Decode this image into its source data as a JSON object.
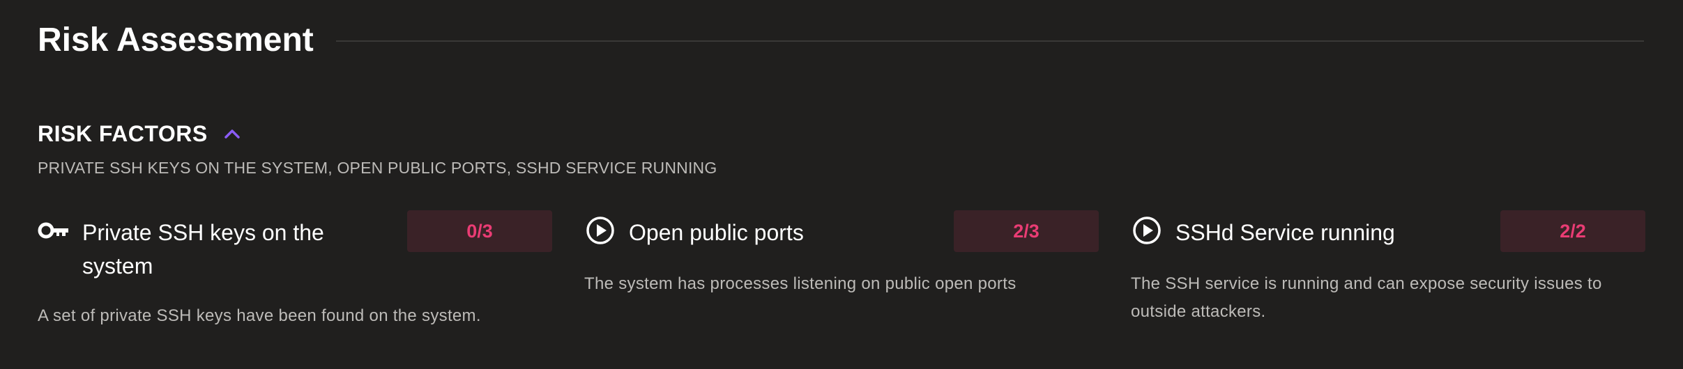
{
  "section": {
    "title": "Risk Assessment"
  },
  "risk_factors": {
    "heading": "RISK FACTORS",
    "summary": "PRIVATE SSH KEYS ON THE SYSTEM, OPEN PUBLIC PORTS, SSHD SERVICE RUNNING",
    "items": [
      {
        "icon": "key-icon",
        "title": "Private SSH keys on the system",
        "count": "0/3",
        "description": "A set of private SSH keys have been found on the system."
      },
      {
        "icon": "play-circle-icon",
        "title": "Open public ports",
        "count": "2/3",
        "description": "The system has processes listening on public open ports"
      },
      {
        "icon": "play-circle-icon",
        "title": "SSHd Service running",
        "count": "2/2",
        "description": "The SSH service is running and can expose security issues to outside attackers."
      }
    ]
  },
  "colors": {
    "background": "#201f1e",
    "accent": "#8b5cf6",
    "count_text": "#ea3c74",
    "count_bg": "#3a2227"
  }
}
